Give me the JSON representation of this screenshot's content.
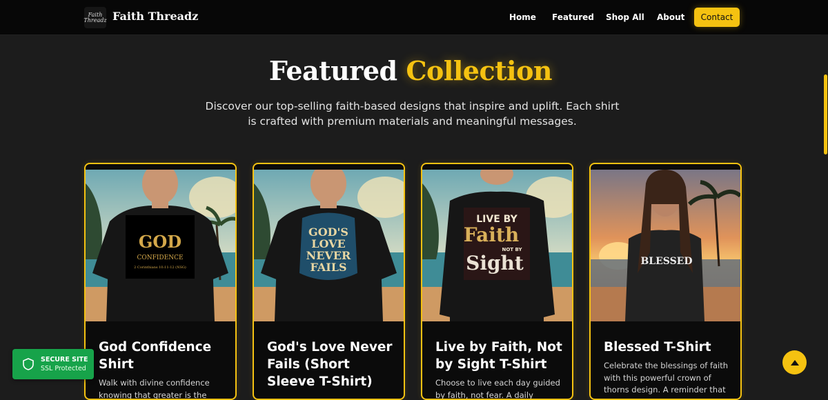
{
  "header": {
    "logo_mark": "Faith Threadz",
    "brand": "Faith Threadz",
    "nav": [
      "Home",
      "Featured",
      "Shop All",
      "About"
    ],
    "contact_label": "Contact"
  },
  "section": {
    "title_main": "Featured",
    "title_accent": "Collection",
    "subtitle": "Discover our top-selling faith-based designs that inspire and uplift. Each shirt is crafted with premium materials and meaningful messages."
  },
  "products": [
    {
      "title": "God Confidence Shirt",
      "description": "Walk with divine confidence knowing that greater is the",
      "shirt_print": [
        "GOD",
        "CONFIDENCE",
        "2 Corinthians 10:11-12 (NSG)"
      ]
    },
    {
      "title": "God's Love Never Fails (Short Sleeve T-Shirt)",
      "description": "",
      "shirt_print": [
        "GOD'S",
        "LOVE",
        "NEVER",
        "FAILS"
      ]
    },
    {
      "title": "Live by Faith, Not by Sight T-Shirt",
      "description": "Choose to live each day guided by faith, not fear. A daily reminder to",
      "shirt_print": [
        "LIVE BY",
        "Faith",
        "NOT BY",
        "Sight"
      ]
    },
    {
      "title": "Blessed T-Shirt",
      "description": "Celebrate the blessings of faith with this powerful crown of thorns design. A reminder that through",
      "shirt_print": [
        "BLESSED"
      ]
    }
  ],
  "secure_badge": {
    "line1": "SECURE SITE",
    "line2": "SSL Protected"
  },
  "colors": {
    "accent": "#f5c211",
    "background": "#1c1c1c",
    "header": "#070707",
    "secure": "#17a34a"
  },
  "icons": [
    "shield-icon",
    "chevron-up-icon"
  ]
}
